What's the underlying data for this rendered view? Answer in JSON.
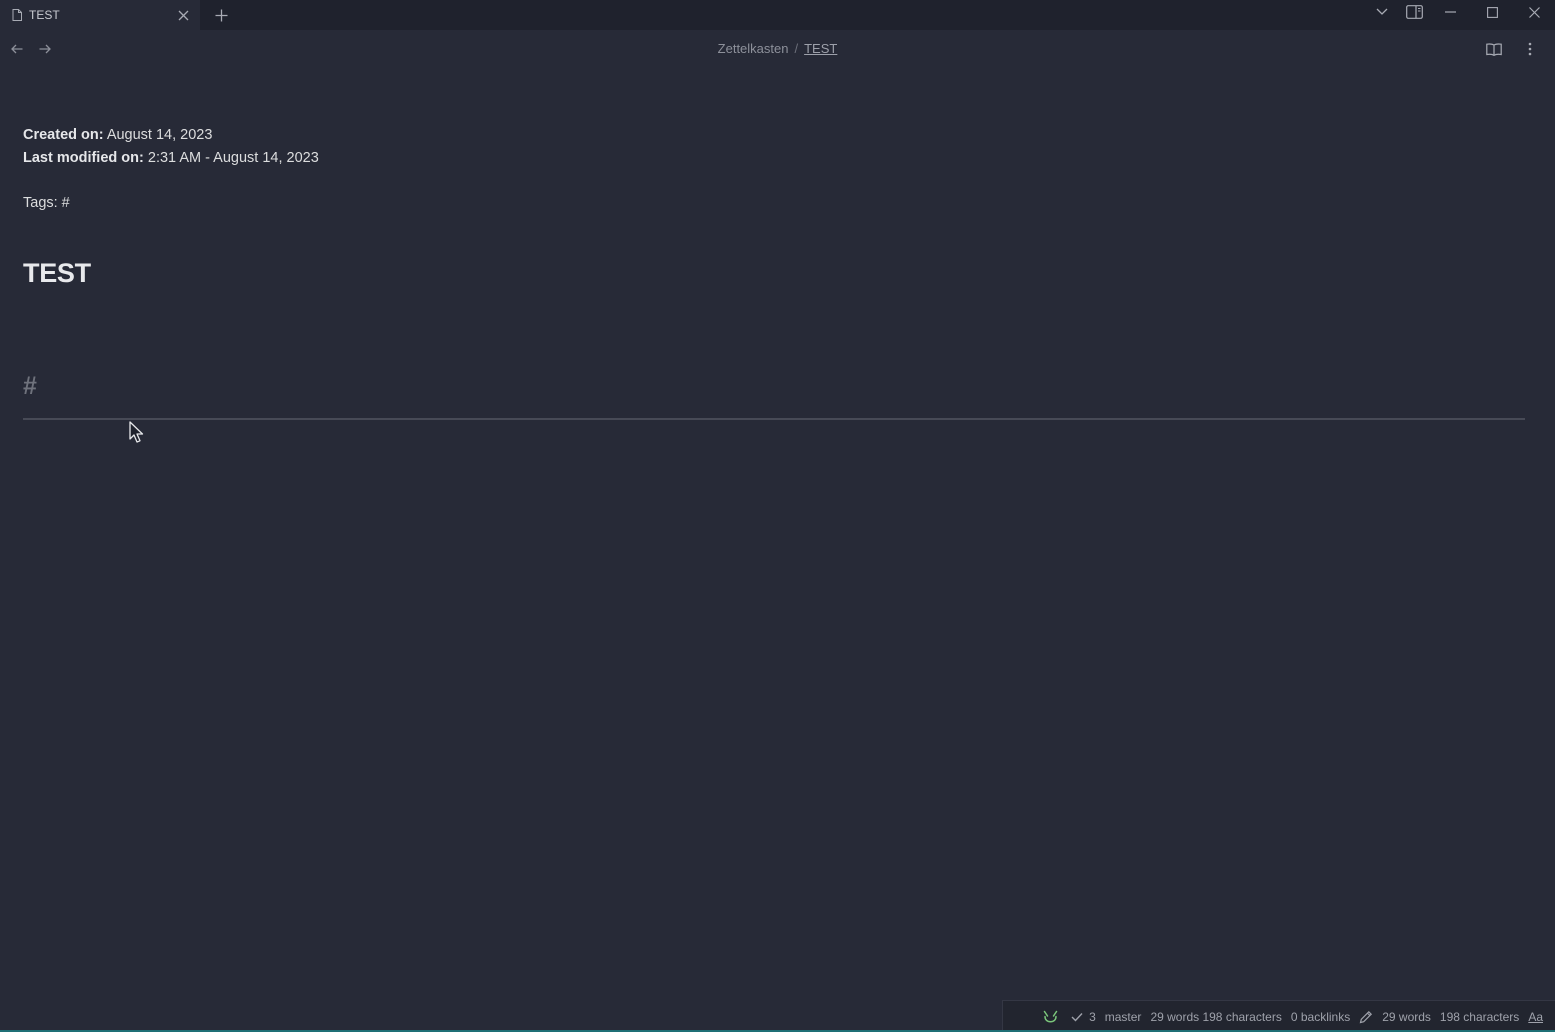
{
  "tab": {
    "title": "TEST",
    "icons": {
      "file": "file-icon",
      "close": "close-icon",
      "new_tab": "plus-icon"
    }
  },
  "window_controls": [
    "chevron-down-icon",
    "sidebar-toggle-icon",
    "minimize-icon",
    "maximize-icon",
    "close-icon"
  ],
  "navigation": {
    "back_icon": "arrow-left-icon",
    "forward_icon": "arrow-right-icon",
    "breadcrumb": {
      "parent": "Zettelkasten",
      "separator": "/",
      "current": "TEST"
    },
    "reading_view_icon": "book-icon",
    "more_options_icon": "more-vertical-icon"
  },
  "note": {
    "created_label": "Created on:",
    "created_value": "August 14, 2023",
    "modified_label": "Last modified on:",
    "modified_value": "2:31 AM - August 14, 2023",
    "tags_text": "Tags: #",
    "title": "TEST",
    "empty_heading": "#"
  },
  "statusbar": {
    "sync_icon": "sync-status-icon",
    "commit_count": "3",
    "branch": "master",
    "word_char_summary": "29 words 198 characters",
    "backlinks": "0 backlinks",
    "words": "29 words",
    "characters": "198 characters",
    "font_toggle": "Aa"
  },
  "colors": {
    "background": "#272a37",
    "titlebar": "#1f222d",
    "text": "#dcddde",
    "muted": "#8d909a",
    "accent_green": "#7bc67b"
  }
}
